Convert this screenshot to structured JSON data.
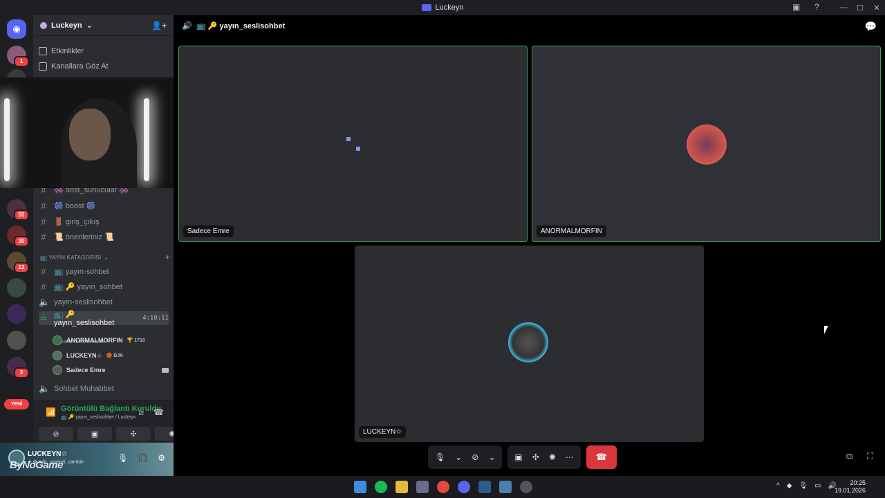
{
  "window": {
    "title": "Luckeyn"
  },
  "server": {
    "name": "Luckeyn"
  },
  "menu": [
    {
      "label": "Etkinlikler"
    },
    {
      "label": "Kanallara Göz At"
    }
  ],
  "guild_badges": [
    "1",
    "50",
    "30",
    "12",
    "3"
  ],
  "guild_new_label": "YENİ",
  "channels": [
    {
      "label": "👭 dost_sunucular 👭"
    },
    {
      "label": "🎆 boost 🎆"
    },
    {
      "label": "🚪 giriş_çıkış"
    },
    {
      "label": "📜 önerileriniz 📜"
    }
  ],
  "category": {
    "label": "📺 YAYIN KATAGORİSİ"
  },
  "stream_channels": [
    {
      "label": "📺 yayın-sohbet",
      "type": "text"
    },
    {
      "label": "📺 🔑 yayın_sohbet",
      "type": "text"
    },
    {
      "label": "yayın-seslisohbet",
      "type": "voice"
    },
    {
      "label": "📺 🔑 yayın_seslisohbet",
      "type": "voice",
      "time": "4:10:11"
    }
  ],
  "channel_status": "Bir kanal durumu belirle ✏",
  "voice_users": [
    {
      "name": "ANORMALMORFIN",
      "tag": "🏆 1710"
    },
    {
      "name": "LUCKEYN☆",
      "tag": "🏀 BJK"
    },
    {
      "name": "Sadece Emre",
      "tag": ""
    }
  ],
  "next_channel": "Sohbet Muhabbet",
  "voice_panel": {
    "title": "Görüntülü Bağlantı Kuruldu",
    "sub": "📺 🔑 yayın_seslisohbet / Luckeyn"
  },
  "user_panel": {
    "name": "LUCKEYN☆",
    "status": "✦ ✿ rufri, sorendi, cambie"
  },
  "watermark": "ByNoGame",
  "stage": {
    "channel": "📺 🔑 yayın_seslisohbet",
    "tiles": [
      {
        "label": "Sadece Emre"
      },
      {
        "label": "ANORMALMORFIN"
      },
      {
        "label": "LUCKEYN☆"
      }
    ]
  },
  "clock": {
    "time": "20:25",
    "date": "19.01.2026"
  },
  "colors": {
    "accent": "#5865f2",
    "speaking": "#3ba55d",
    "hangup": "#da373c",
    "online": "#23a55a"
  }
}
